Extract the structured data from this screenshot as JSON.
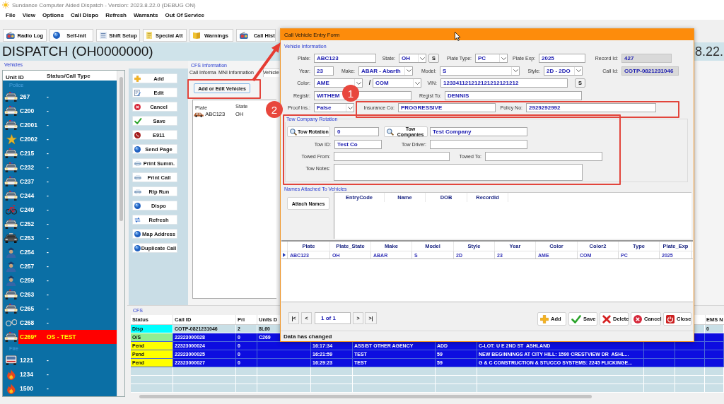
{
  "window": {
    "title": "Sundance Computer Aided Dispatch - Version: 2023.8.22.0 (DEBUG ON)"
  },
  "menu": [
    "File",
    "View",
    "Options",
    "Call Dispo",
    "Refresh",
    "Warrants",
    "Out Of Service"
  ],
  "toolbar": [
    "Radio Log",
    "Self-Init",
    "Shift Setup",
    "Special Att",
    "Warnings",
    "Call Hist"
  ],
  "banner": {
    "title": "DISPATCH (OH0000000)",
    "date": "8.22."
  },
  "vehicles": {
    "label": "Vehicles",
    "columns": [
      "Unit ID",
      "Status/Call Type"
    ],
    "groups": [
      {
        "label": "Police",
        "units": [
          {
            "unit": "267",
            "status": "-"
          },
          {
            "unit": "C200",
            "status": "-"
          },
          {
            "unit": "C2001",
            "status": "-"
          },
          {
            "unit": "C2002",
            "status": "-"
          },
          {
            "unit": "C215",
            "status": "-"
          },
          {
            "unit": "C232",
            "status": "-"
          },
          {
            "unit": "C237",
            "status": "-"
          },
          {
            "unit": "C244",
            "status": "-"
          },
          {
            "unit": "C249",
            "status": "-"
          },
          {
            "unit": "C252",
            "status": "-"
          },
          {
            "unit": "C253",
            "status": "-"
          },
          {
            "unit": "C254",
            "status": "-"
          },
          {
            "unit": "C257",
            "status": "-"
          },
          {
            "unit": "C259",
            "status": "-"
          },
          {
            "unit": "C263",
            "status": "-"
          },
          {
            "unit": "C265",
            "status": "-"
          },
          {
            "unit": "C268",
            "status": "-"
          },
          {
            "unit": "C269*",
            "status": "OS - TEST",
            "color": "#ff0000"
          }
        ]
      },
      {
        "label": "Fire",
        "units": [
          {
            "unit": "1221",
            "status": "-"
          },
          {
            "unit": "1234",
            "status": "-"
          },
          {
            "unit": "1500",
            "status": "-"
          }
        ]
      }
    ]
  },
  "actions": [
    "Add",
    "Edit",
    "Cancel",
    "Save",
    "E911",
    "Send Page",
    "Print Summ.",
    "Print Call",
    "Rip Run",
    "Dispo",
    "Refresh",
    "Map Address",
    "Duplicate Call"
  ],
  "cfs_information": {
    "label": "CFS Information",
    "tabs": [
      {
        "label": "Call Informa",
        "selected": false
      },
      {
        "label": "MNI Information",
        "selected": false
      },
      {
        "label": "Vehicle",
        "selected": true
      }
    ],
    "button": "Add or Edit Vehicles",
    "list": {
      "columns": [
        "Plate",
        "State"
      ],
      "rows": [
        [
          "ABC123",
          "OH"
        ]
      ]
    }
  },
  "cfs": {
    "label": "CFS",
    "columns": [
      "Status",
      "Call ID",
      "Pri",
      "Units D"
    ],
    "last_column": "EMS N",
    "rows": [
      {
        "highlighted": false,
        "status": {
          "text": "Disp",
          "color": "#00ffff"
        },
        "call_id": "COTP-0821231046",
        "pri": "2",
        "units_d": "8L60",
        "ems_n": "0"
      },
      {
        "highlighted": true,
        "status": {
          "text": "O/S",
          "color": "#90ee90"
        },
        "call_id": "22323000028",
        "pri": "0",
        "units_d": "C269"
      },
      {
        "highlighted": true,
        "status": {
          "text": "Pend",
          "color": "#ffff00"
        },
        "call_id": "22323000024",
        "pri": "0",
        "column_5": "16:17:34",
        "column_6": "ASSIST OTHER AGENCY",
        "column_7": "ADD",
        "column_8": "C-LOT: U E 2ND ST  ASHLAND"
      },
      {
        "highlighted": true,
        "status": {
          "text": "Pend",
          "color": "#ffff00"
        },
        "call_id": "22323000025",
        "pri": "0",
        "column_5": "16:21:59",
        "column_6": "TEST",
        "column_7": "59",
        "column_8": "NEW BEGINNINGS AT CITY HILL: 1590 CRESTVIEW DR  ASHL..."
      },
      {
        "highlighted": true,
        "status": {
          "text": "Pend",
          "color": "#ffff00"
        },
        "call_id": "22323000027",
        "pri": "0",
        "column_5": "16:29:23",
        "column_6": "TEST",
        "column_7": "59",
        "column_8": "G & C CONSTRUCTION & STUCCO SYSTEMS: 2245 FLICKINGE..."
      }
    ]
  },
  "dialog": {
    "title": "Call Vehicle Entry Form",
    "vehicle_information": {
      "label": "Vehicle Information",
      "fields": [
        {
          "kind": "field",
          "label": "Plate:",
          "value": "ABC123"
        },
        {
          "kind": "combo",
          "label": "State:",
          "value": "OH"
        },
        {
          "kind": "button",
          "label": "S"
        },
        {
          "kind": "combo",
          "label": "Plate Type:",
          "value": "PC"
        },
        {
          "kind": "field",
          "label": "Plate Exp:",
          "value": "2025"
        },
        {
          "kind": "readonly",
          "label": "Record Id:",
          "value": "427"
        },
        {
          "kind": "field",
          "label": "Year:",
          "value": "23"
        },
        {
          "kind": "combo",
          "label": "Make:",
          "value": "ABAR - Abarth"
        },
        {
          "kind": "combo",
          "label": "Model:",
          "value": "S"
        },
        {
          "kind": "combo",
          "label": "Style:",
          "value": "2D - 2DO"
        },
        {
          "kind": "readonly",
          "label": "Call Id:",
          "value": "COTP-0821231046"
        },
        {
          "kind": "combo",
          "label": "Color:",
          "value": "AME"
        },
        {
          "kind": "text",
          "text": "/"
        },
        {
          "kind": "combo",
          "value": "COM"
        },
        {
          "kind": "field",
          "label": "VIN:",
          "value": "123341121212121212121212"
        },
        {
          "kind": "button",
          "label": "S"
        },
        {
          "kind": "field",
          "label": "Registr:",
          "value": "WITHEM"
        },
        {
          "kind": "field",
          "label": "Regist To:",
          "value": "DENNIS"
        },
        {
          "kind": "combo",
          "label": "Proof Ins.:",
          "value": "False"
        },
        {
          "kind": "field",
          "label": "Insurance Co:",
          "value": "PROGRESSIVE"
        },
        {
          "kind": "field",
          "label": "Policy No:",
          "value": "2929292992"
        }
      ]
    },
    "tow_company_rotation": {
      "label": "Tow Company Rotation",
      "fields": [
        {
          "kind": "search-button",
          "label": "Tow Rotation"
        },
        {
          "kind": "field",
          "value": "0"
        },
        {
          "kind": "search-button",
          "label": "Tow Companies"
        },
        {
          "kind": "field",
          "value": "Test Company"
        },
        {
          "kind": "field",
          "label": "Tow ID:",
          "value": "Test Co"
        },
        {
          "kind": "field",
          "label": "Tow Driver:"
        },
        {
          "kind": "field",
          "label": "Towed From:"
        },
        {
          "kind": "field",
          "label": "Towed To:"
        },
        {
          "kind": "notes",
          "label": "Tow Notes:"
        }
      ]
    },
    "names_attached": {
      "label": "Names Attached To Vehicles",
      "button": "Attach Names",
      "columns": [
        "EntryCode",
        "Name",
        "DOB",
        "RecordId"
      ]
    },
    "vehicles_grid": {
      "columns": [
        "Plate",
        "Plate_State",
        "Make",
        "Model",
        "Style",
        "Year",
        "Color",
        "Color2",
        "Type",
        "Plate_Exp"
      ],
      "rows": [
        {
          "selected": true,
          "cells": [
            "ABC123",
            "OH",
            "ABAR",
            "S",
            "2D",
            "23",
            "AME",
            "COM",
            "PC",
            "2025"
          ]
        }
      ]
    },
    "navigator": {
      "first": "|<",
      "previous": "<",
      "position": "1 of 1",
      "next": ">",
      "last": ">|"
    },
    "buttons": [
      "Add",
      "Save",
      "Delete",
      "Cancel",
      "Close"
    ],
    "status": "Data has changed"
  },
  "annotations": [
    {
      "number": "1"
    },
    {
      "number": "2"
    }
  ]
}
